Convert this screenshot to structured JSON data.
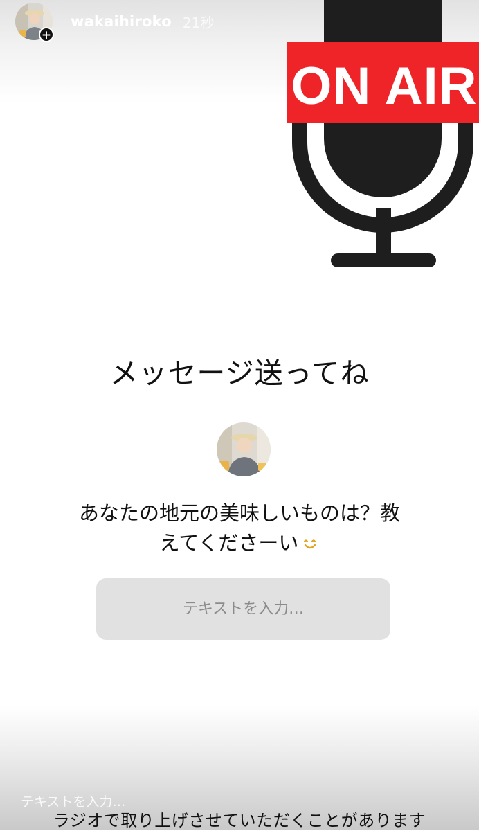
{
  "header": {
    "username": "wakaihiroko",
    "timestamp": "21秒",
    "add_badge": "+"
  },
  "graphic": {
    "label": "ON AIR",
    "label_bg": "#EE2429",
    "mic_color": "#1E1E1E",
    "icon": "microphone-icon"
  },
  "main": {
    "title": "メッセージ送ってね",
    "question": "あなたの地元の美味しいものは？教えてくださーい",
    "emoji": "smile-emoji-icon"
  },
  "answer_box": {
    "placeholder": "テキストを入力…"
  },
  "footer": {
    "hint": "テキストを入力…",
    "caption": "ラジオで取り上げさせていただくことがあります"
  }
}
